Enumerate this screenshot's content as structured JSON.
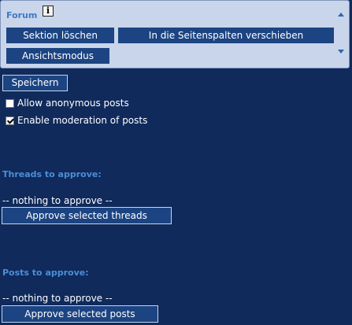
{
  "panel": {
    "title": "Forum",
    "info_glyph": "i",
    "buttons": {
      "delete_section": "Sektion löschen",
      "move_to_sidebar": "In die Seitenspalten verschieben",
      "view_mode": "Ansichtsmodus"
    },
    "icons": {
      "info": "info-icon",
      "up": "arrow-up-icon",
      "down": "arrow-down-icon"
    }
  },
  "save_label": "Speichern",
  "options": {
    "allow_anonymous": {
      "label": "Allow anonymous posts",
      "checked": false
    },
    "enable_moderation": {
      "label": "Enable moderation of posts",
      "checked": true
    }
  },
  "threads": {
    "title": "Threads to approve:",
    "empty": "-- nothing to approve --",
    "button": "Approve selected threads"
  },
  "posts": {
    "title": "Posts to approve:",
    "empty": "-- nothing to approve --",
    "button": "Approve selected posts"
  },
  "colors": {
    "background": "#102a5c",
    "panel": "#c9d5ea",
    "button": "#1c4482",
    "section_title": "#4b8ed7"
  }
}
